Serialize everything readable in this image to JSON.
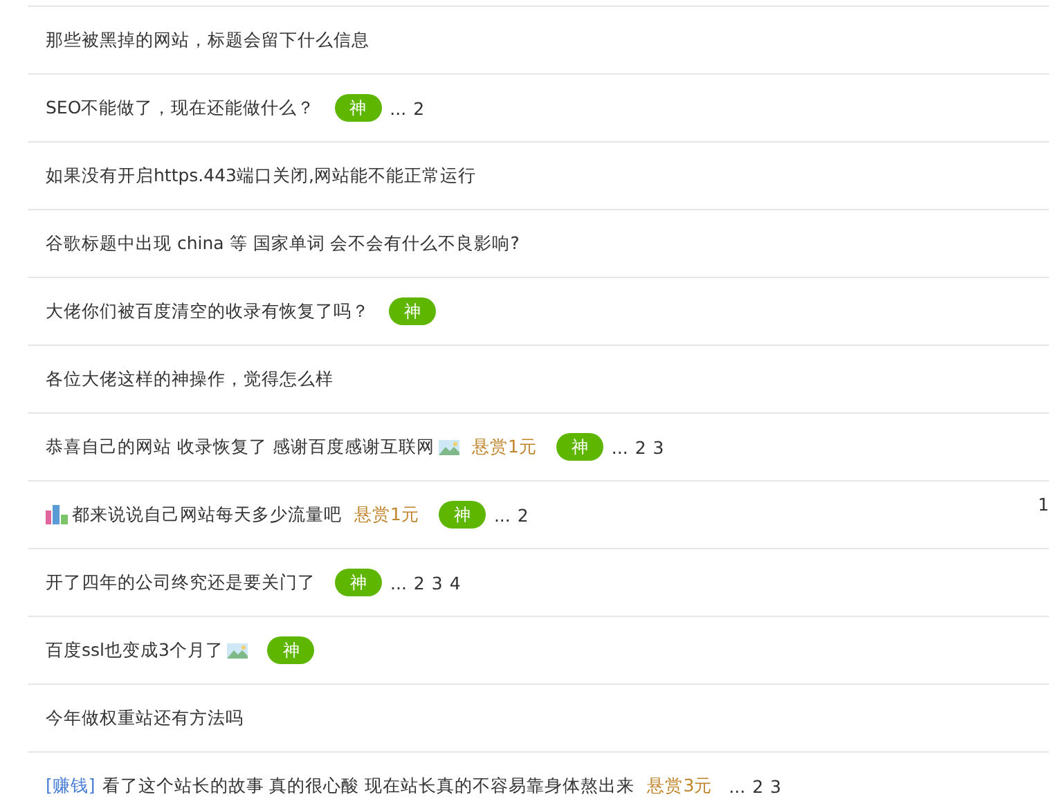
{
  "threads": [
    {
      "title": "那些被黑掉的网站，标题会留下什么信息"
    },
    {
      "title": "SEO不能做了，现在还能做什么？",
      "badge": "神",
      "pages": {
        "lead": "...",
        "numbers": [
          "2"
        ]
      }
    },
    {
      "title": "如果没有开启https.443端口关闭,网站能不能正常运行"
    },
    {
      "title": "谷歌标题中出现 china 等 国家单词 会不会有什么不良影响?"
    },
    {
      "title": "大佬你们被百度清空的收录有恢复了吗？",
      "badge": "神"
    },
    {
      "title": "各位大佬这样的神操作，觉得怎么样"
    },
    {
      "title": "恭喜自己的网站 收录恢复了 感谢百度感谢互联网",
      "has_image": true,
      "reward": "悬赏1元",
      "badge": "神",
      "pages": {
        "lead": "...",
        "numbers": [
          "2",
          "3"
        ]
      }
    },
    {
      "title": "都来说说自己网站每天多少流量吧",
      "poll": true,
      "reward": "悬赏1元",
      "badge": "神",
      "pages": {
        "lead": "...",
        "numbers": [
          "2"
        ]
      },
      "side_text": "1"
    },
    {
      "title": "开了四年的公司终究还是要关门了",
      "badge": "神",
      "pages": {
        "lead": "...",
        "numbers": [
          "2",
          "3",
          "4"
        ]
      }
    },
    {
      "title": "百度ssl也变成3个月了",
      "has_image": true,
      "badge": "神"
    },
    {
      "title": "今年做权重站还有方法吗"
    },
    {
      "category": "[赚钱]",
      "title": "看了这个站长的故事 真的很心酸 现在站长真的不容易靠身体熬出来",
      "reward": "悬赏3元",
      "pages": {
        "lead": "...",
        "numbers": [
          "2",
          "3"
        ]
      }
    }
  ]
}
